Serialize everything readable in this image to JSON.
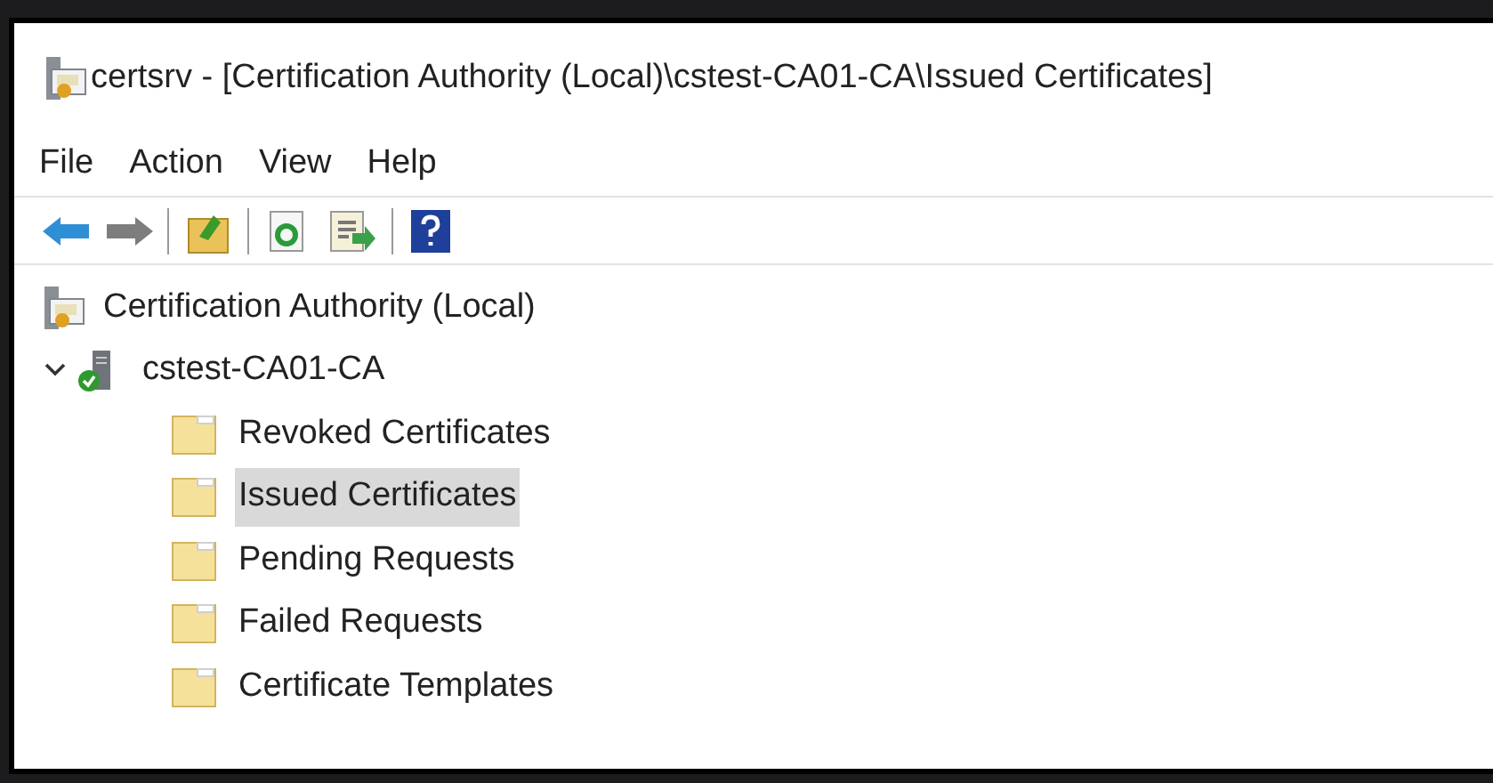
{
  "window": {
    "title": "certsrv - [Certification Authority (Local)\\cstest-CA01-CA\\Issued Certificates]"
  },
  "menu": [
    "File",
    "Action",
    "View",
    "Help"
  ],
  "tree": [
    {
      "label": "Certification Authority (Local)",
      "kind": "root",
      "selected": false,
      "children": [
        {
          "label": "cstest-CA01-CA",
          "kind": "server",
          "expanded": true,
          "selected": false,
          "children": [
            {
              "label": "Revoked Certificates",
              "kind": "folder",
              "selected": false
            },
            {
              "label": "Issued Certificates",
              "kind": "folder",
              "selected": true
            },
            {
              "label": "Pending Requests",
              "kind": "folder",
              "selected": false
            },
            {
              "label": "Failed Requests",
              "kind": "folder",
              "selected": false
            },
            {
              "label": "Certificate Templates",
              "kind": "folder",
              "selected": false
            }
          ]
        }
      ]
    }
  ]
}
